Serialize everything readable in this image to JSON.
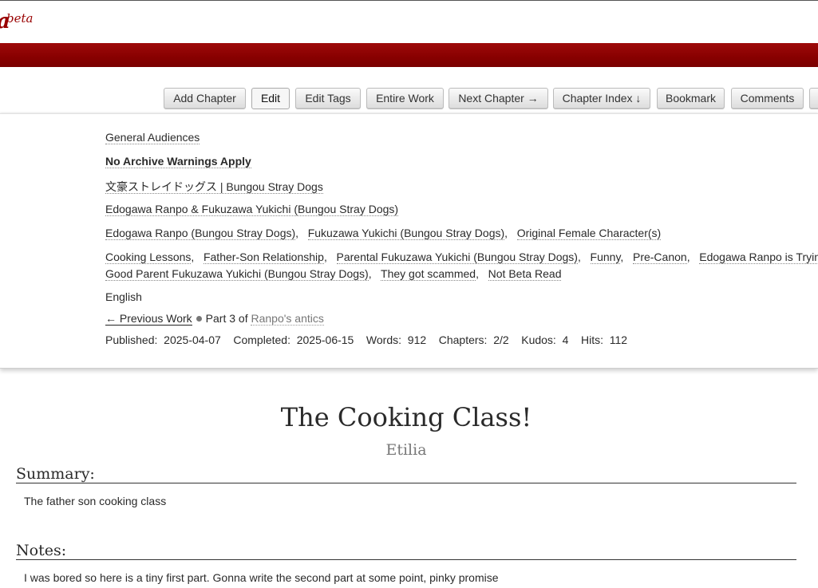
{
  "header": {
    "logo_letter": "a",
    "beta_label": "beta"
  },
  "actions": {
    "add_chapter": "Add Chapter",
    "edit": "Edit",
    "edit_tags": "Edit Tags",
    "entire_work": "Entire Work",
    "next_chapter": "Next Chapter →",
    "chapter_index": "Chapter Index ↓",
    "bookmark": "Bookmark",
    "comments": "Comments"
  },
  "meta": {
    "rating": "General Audiences",
    "warning": "No Archive Warnings Apply",
    "fandom": "文豪ストレイドッグス | Bungou Stray Dogs",
    "relationship": "Edogawa Ranpo & Fukuzawa Yukichi (Bungou Stray Dogs)",
    "characters": [
      "Edogawa Ranpo (Bungou Stray Dogs)",
      "Fukuzawa Yukichi (Bungou Stray Dogs)",
      "Original Female Character(s)"
    ],
    "freeforms_line1": [
      "Cooking Lessons",
      "Father-Son Relationship",
      "Parental Fukuzawa Yukichi (Bungou Stray Dogs)",
      "Funny",
      "Pre-Canon",
      "Edogawa Ranpo is Trying"
    ],
    "freeforms_line2": [
      "Good Parent Fukuzawa Yukichi (Bungou Stray Dogs)",
      "They got scammed",
      "Not Beta Read"
    ],
    "language": "English",
    "series": {
      "prev": "← Previous Work",
      "part_text": "Part 3 of",
      "name": "Ranpo's antics"
    },
    "stats": {
      "published_label": "Published:",
      "published": "2025-04-07",
      "completed_label": "Completed:",
      "completed": "2025-06-15",
      "words_label": "Words:",
      "words": "912",
      "chapters_label": "Chapters:",
      "chapters": "2/2",
      "kudos_label": "Kudos:",
      "kudos": "4",
      "hits_label": "Hits:",
      "hits": "112"
    }
  },
  "work": {
    "title": "The Cooking Class!",
    "author": "Etilia",
    "summary_heading": "Summary:",
    "summary": "The father son cooking class",
    "notes_heading": "Notes:",
    "notes": "I was bored so here is a tiny first part. Gonna write the second part at some point, pinky promise"
  }
}
